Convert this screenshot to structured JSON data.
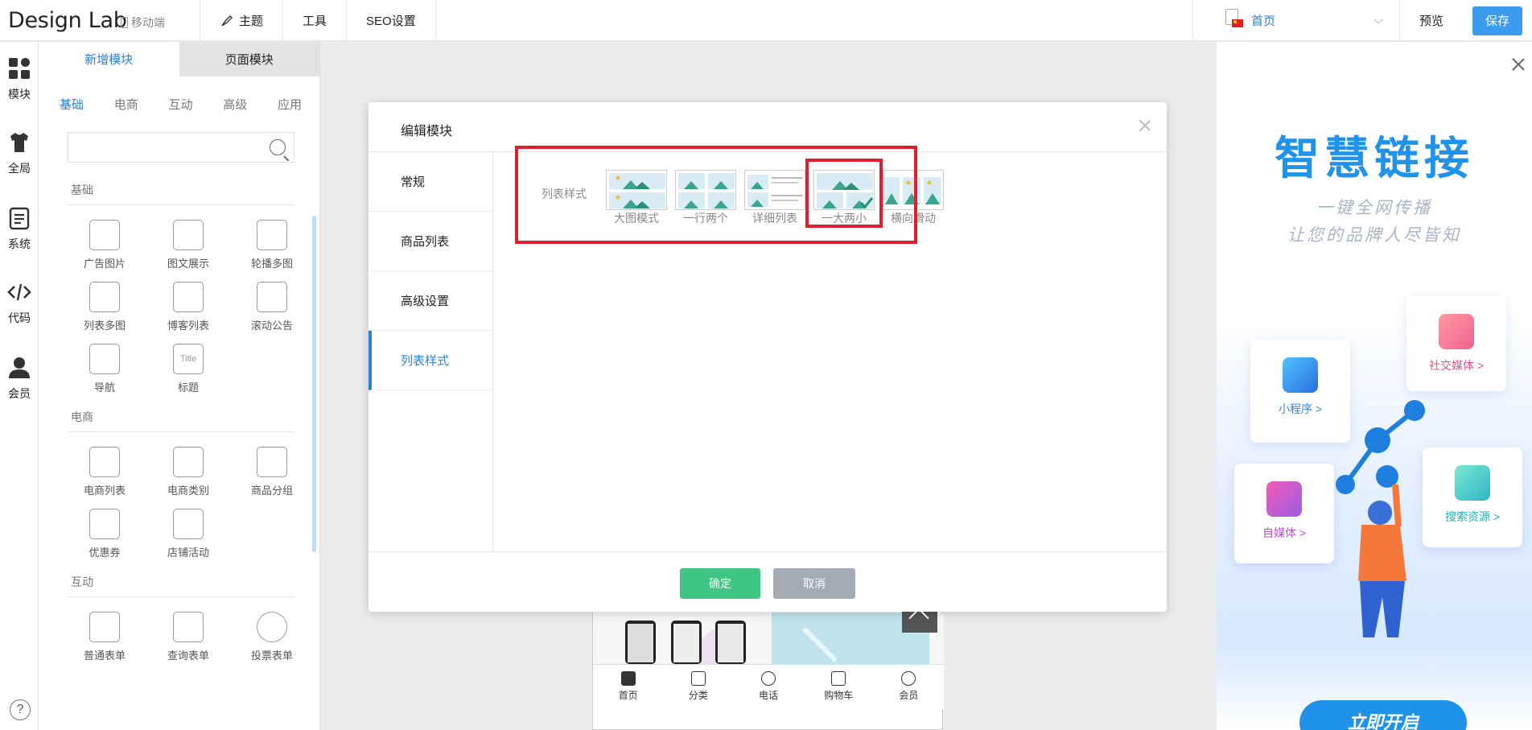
{
  "header": {
    "logo": "Design Lab",
    "device_label": "移动端",
    "nav": [
      "主题",
      "工具",
      "SEO设置"
    ],
    "current_page": "首页",
    "preview_label": "预览",
    "save_label": "保存"
  },
  "rail": [
    "模块",
    "全局",
    "系统",
    "代码",
    "会员"
  ],
  "panel": {
    "tabs": [
      "新增模块",
      "页面模块"
    ],
    "subtabs": [
      "基础",
      "电商",
      "互动",
      "高级",
      "应用"
    ],
    "search_placeholder": "",
    "sections": [
      {
        "title": "基础",
        "items": [
          "广告图片",
          "图文展示",
          "轮播多图",
          "列表多图",
          "博客列表",
          "滚动公告",
          "导航",
          "标题"
        ]
      },
      {
        "title": "电商",
        "items": [
          "电商列表",
          "电商类别",
          "商品分组",
          "优惠券",
          "店铺活动"
        ]
      },
      {
        "title": "互动",
        "items": [
          "普通表单",
          "查询表单",
          "投票表单"
        ]
      }
    ]
  },
  "phone_preview": {
    "bottom_nav": [
      "首页",
      "分类",
      "电话",
      "购物车",
      "会员"
    ]
  },
  "modal": {
    "title": "编辑模块",
    "nav": [
      "常规",
      "商品列表",
      "高级设置",
      "列表样式"
    ],
    "active_nav": "列表样式",
    "style_label": "列表样式",
    "options": [
      "大图模式",
      "一行两个",
      "详细列表",
      "一大两小",
      "横向滑动"
    ],
    "selected_option": "一大两小",
    "ok_label": "确定",
    "cancel_label": "取消"
  },
  "promo": {
    "title": "智慧链接",
    "subtitle_1": "一键全网传播",
    "subtitle_2": "让您的品牌人尽皆知",
    "cards": [
      "小程序 >",
      "社交媒体 >",
      "自媒体 >",
      "搜索资源 >"
    ],
    "cta": "立即开启"
  },
  "colors": {
    "accent": "#2b7fd9",
    "save": "#3a9bef",
    "ok": "#3fc584",
    "cancel": "#a3acb5",
    "highlight": "#e11d2e"
  }
}
